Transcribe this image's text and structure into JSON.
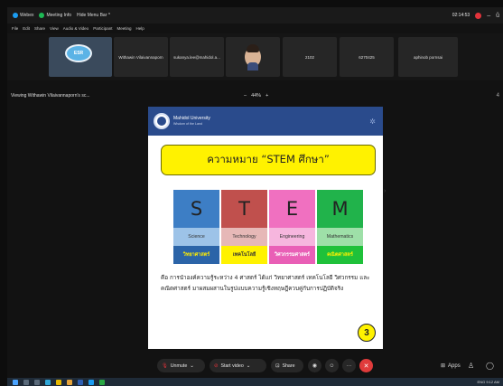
{
  "titlebar": {
    "webex": "Webex",
    "meeting_info": "Meeting Info",
    "hide_menu": "Hide Menu Bar ^",
    "timer": "02:14:53",
    "minimize": "–",
    "close": "ŭ"
  },
  "menu": [
    "File",
    "Edit",
    "Share",
    "View",
    "Audio & Video",
    "Participant",
    "Meeting",
    "Help"
  ],
  "participants": [
    {
      "name": "",
      "badge": "ESR"
    },
    {
      "name": "Withawin Vilaivannaporn"
    },
    {
      "name": "sukanya.lee@mahidol.a..."
    },
    {
      "name": ""
    },
    {
      "name": "2102"
    },
    {
      "name": "6270425"
    },
    {
      "name": "aphinob pornsai"
    }
  ],
  "view": {
    "viewing": "Viewing Withawin Vilaivannaporn's sc...",
    "zoom_minus": "–",
    "zoom_level": "44%",
    "zoom_plus": "+",
    "right_marker": "4"
  },
  "slide": {
    "university": "Mahidol University",
    "university_sub": "Wisdom of the Land",
    "title": "ความหมาย “STEM ศึกษา”",
    "stem": [
      {
        "letter": "S",
        "english": "Science",
        "thai": "วิทยาศาสตร์"
      },
      {
        "letter": "T",
        "english": "Technology",
        "thai": "เทคโนโลยี"
      },
      {
        "letter": "E",
        "english": "Engineering",
        "thai": "วิศวกรรมศาสตร์"
      },
      {
        "letter": "M",
        "english": "Mathematics",
        "thai": "คณิตศาสตร์"
      }
    ],
    "description": "คือ การนำองค์ความรู้ระหว่าง 4 ศาสตร์ ได้แก่ วิทยาศาสตร์ เทคโนโลยี วิศวกรรม และ คณิตศาสตร์ มาผสมผสานในรูปแบบความรู้เชิงทฤษฎีควบคู่กับการปฏิบัติจริง",
    "page": "3"
  },
  "toolbar": {
    "unmute": "Unmute",
    "start_video": "Start video",
    "share": "Share",
    "apps": "Apps"
  },
  "taskbar": {
    "lang": "ENG",
    "time": "9:12 AM"
  }
}
